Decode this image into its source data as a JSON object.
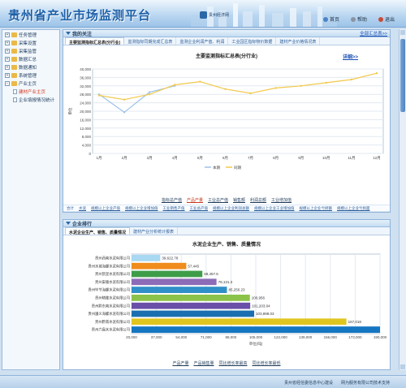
{
  "header": {
    "title": "贵州省产业市场监测平台",
    "logo_text": "贵州经济网",
    "links": [
      "首页",
      "帮助",
      "退出"
    ]
  },
  "sidebar": {
    "items": [
      {
        "label": "任务管理",
        "type": "folder"
      },
      {
        "label": "采集设置",
        "type": "folder"
      },
      {
        "label": "采集监管",
        "type": "folder"
      },
      {
        "label": "数据汇总",
        "type": "folder"
      },
      {
        "label": "数据通知",
        "type": "folder"
      },
      {
        "label": "系统管理",
        "type": "folder"
      },
      {
        "label": "产业主页",
        "type": "folder"
      },
      {
        "label": "建材产业主页",
        "type": "page",
        "active": true
      },
      {
        "label": "企业填报情况统计",
        "type": "page"
      }
    ]
  },
  "panel1": {
    "title": "我的关注",
    "more": "全部汇总表>>",
    "tabs": [
      "主要监测指标汇总表(分行业)",
      "监测指标同期完成汇总表",
      "监测企业利润产值、利润",
      "工业园区指标物价数据",
      "建材产业价格情况表"
    ],
    "detail_link": "详细>>",
    "subnav": [
      "指标总产值",
      "产品产量",
      "工业总产值",
      "销售额",
      "利润总额",
      "工业增加值"
    ],
    "subnav_active": 1,
    "table_headers": [
      "合计",
      "水泥",
      "规模以上企业产值",
      "规模以上企业增加值",
      "工业销售产值",
      "工业总产值",
      "规模以上企业利润总额",
      "规模以上企业工业增加值",
      "规模以上企业亏损额",
      "规模以上企业亏损面"
    ]
  },
  "panel2": {
    "title": "企业排行",
    "tabs": [
      "水泥企业生产、销售、质量情况",
      "建材产业分析统计报表"
    ],
    "subnav": [
      "产品产量",
      "产品销售量",
      "同比增长率最高",
      "同比增长率最低"
    ]
  },
  "footer": {
    "text1": "贵州省经信委信息中心建设",
    "text2": "网为服务有限公司技术支持"
  },
  "chart_data": [
    {
      "type": "line",
      "title": "主要监测指标汇总表(分行业)",
      "ylabel": "单位",
      "categories": [
        "1月",
        "2月",
        "3月",
        "4月",
        "5月",
        "6月",
        "7月",
        "8月",
        "9月",
        "10月",
        "11月",
        "12月"
      ],
      "ylim": [
        0,
        40000
      ],
      "yticks": [
        0,
        4000,
        8000,
        12000,
        16000,
        20000,
        24000,
        28000,
        32000,
        36000,
        40000
      ],
      "ytick_labels": [
        "0",
        "4,000",
        "8,000",
        "12,000",
        "16,000",
        "20,000",
        "24,000",
        "28,000",
        "32,000",
        "36,000",
        "40,000"
      ],
      "series": [
        {
          "name": "本期",
          "color": "#9cc3e8",
          "values": [
            28000,
            19500,
            29000,
            32000
          ]
        },
        {
          "name": "同期",
          "color": "#f2c84b",
          "values": [
            27500,
            25500,
            28000,
            32500,
            34000,
            30500,
            28500,
            31000,
            32000,
            33500,
            35000,
            38000
          ]
        }
      ],
      "legend": "bottom"
    },
    {
      "type": "bar",
      "orientation": "horizontal",
      "title": "水泥企业生产、销售、质量情况",
      "xlabel": "单位(吨)",
      "xlim": [
        20000,
        190000
      ],
      "xticks": [
        20000,
        37000,
        54000,
        71000,
        88000,
        105000,
        122000,
        139000,
        156000,
        173000,
        190000
      ],
      "xtick_labels": [
        "20,000",
        "37,000",
        "54,000",
        "71,000",
        "88,000",
        "105,000",
        "122,000",
        "139,000",
        "156,000",
        "173,000",
        "190,000"
      ],
      "categories": [
        "贵州西南水泥有限公司",
        "贵州水城海螺水泥有限公司",
        "贵州凯里水泥有限公司",
        "贵州安顺水泥有限公司",
        "贵州毕节海螺水泥有限公司",
        "贵州晴隆水泥有限公司",
        "贵州黔东南水泥有限公司",
        "贵州遵义海螺水泥有限公司",
        "贵州黔南水泥有限公司",
        "贵州六盘水水泥有限公司"
      ],
      "values": [
        39622.78,
        57445,
        68457.6,
        78131.3,
        85250.23,
        100956,
        101203.04,
        103898.03,
        167018,
        190000
      ],
      "value_labels": [
        "39,622.78",
        "57,445",
        "68,457.6",
        "78,131.3",
        "85,250.23",
        "100,956",
        "101,203.04",
        "103,898.03",
        "167,018",
        ""
      ],
      "colors": [
        "#a9d8f2",
        "#f08c1c",
        "#3f9d49",
        "#8c6bb8",
        "#2f8fc8",
        "#8bc34a",
        "#6a4fa8",
        "#1a6fb0",
        "#e1c51f",
        "#1576c2"
      ]
    }
  ]
}
